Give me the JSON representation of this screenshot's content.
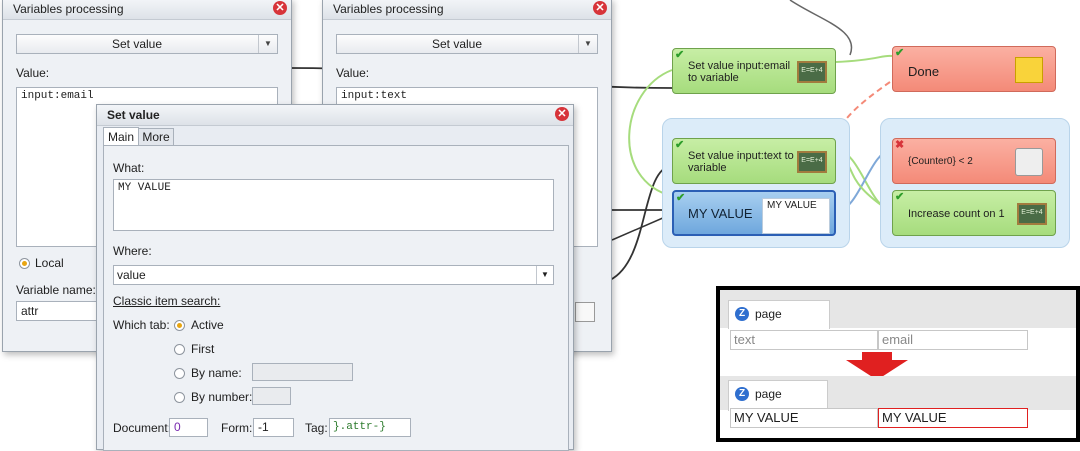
{
  "dialog1": {
    "title": "Variables processing",
    "action": "Set value",
    "value_label": "Value:",
    "value_text": "input:email",
    "local_label": "Local",
    "varname_label": "Variable name:",
    "varname_value": "attr"
  },
  "dialog2": {
    "title": "Variables processing",
    "action": "Set value",
    "value_label": "Value:",
    "value_text": "input:text"
  },
  "dialog3": {
    "title": "Set value",
    "tabs": [
      "Main",
      "More"
    ],
    "what_label": "What:",
    "what_value": "MY VALUE",
    "where_label": "Where:",
    "where_value": "value",
    "classic_label": "Classic item search:",
    "which_tab_label": "Which tab:",
    "opt_active": "Active",
    "opt_first": "First",
    "opt_byname": "By name:",
    "opt_bynumber": "By number:",
    "document_label": "Document:",
    "document_value": "0",
    "form_label": "Form:",
    "form_value": "-1",
    "tag_label": "Tag:",
    "tag_value": "}.attr-}"
  },
  "canvas": {
    "node_email": "Set value input:email to variable",
    "node_done": "Done",
    "node_text": "Set value input:text to variable",
    "node_counter": "{Counter0} < 2",
    "node_myvalue": "MY VALUE",
    "node_myvalue_tooltip": "MY VALUE",
    "node_increase": "Increase count on 1",
    "board_text": "E=E+4"
  },
  "browser": {
    "tab_label": "page",
    "before": {
      "field1": "text",
      "field2": "email"
    },
    "after": {
      "field1": "MY VALUE",
      "field2": "MY VALUE"
    }
  },
  "colors": {
    "accent_red": "#e02020",
    "radio_on": "#e8a511",
    "node_green": "#a6dc7d",
    "node_red": "#f48a78",
    "node_blue": "#6ea7dd"
  }
}
